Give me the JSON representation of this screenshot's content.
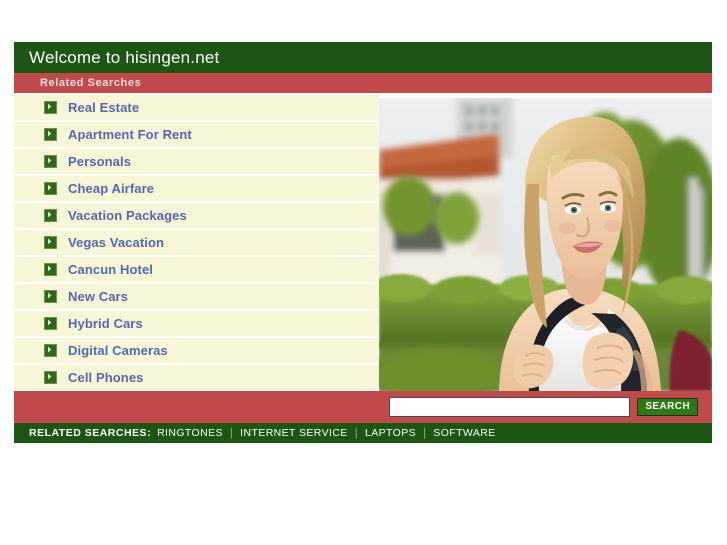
{
  "header": {
    "title": "Welcome to hisingen.net",
    "sub_title": "Related Searches",
    "title_bar_color": "#1b5713",
    "sub_bar_color": "#c24a4a"
  },
  "related_searches": {
    "items": [
      {
        "label": "Real Estate",
        "icon": "arrow-right-icon"
      },
      {
        "label": "Apartment For Rent",
        "icon": "arrow-right-icon"
      },
      {
        "label": "Personals",
        "icon": "arrow-right-icon"
      },
      {
        "label": "Cheap Airfare",
        "icon": "arrow-right-icon"
      },
      {
        "label": "Vacation Packages",
        "icon": "arrow-right-icon"
      },
      {
        "label": "Vegas Vacation",
        "icon": "arrow-right-icon"
      },
      {
        "label": "Cancun Hotel",
        "icon": "arrow-right-icon"
      },
      {
        "label": "New Cars",
        "icon": "arrow-right-icon"
      },
      {
        "label": "Hybrid Cars",
        "icon": "arrow-right-icon"
      },
      {
        "label": "Digital Cameras",
        "icon": "arrow-right-icon"
      },
      {
        "label": "Cell Phones",
        "icon": "arrow-right-icon"
      }
    ],
    "link_color": "#5566b5",
    "row_color": "#f7f7d8"
  },
  "photo": {
    "alt": "Smiling blonde young woman wearing a white top and a black backpack, standing outdoors in front of a tiled-roof building with green hedges and trees",
    "sky_color": "#e9ecec",
    "roof_color": "#c86a42",
    "hedge_color": "#6f9130",
    "hair_color": "#d9b778",
    "skin_color": "#f0cdab",
    "shirt_color": "#fdfdfd",
    "strap_color": "#1c2026"
  },
  "search": {
    "value": "",
    "placeholder": "",
    "button_label": "SEARCH",
    "button_color": "#2d7a14",
    "bar_color": "#c24a4a"
  },
  "footer": {
    "title": "RELATED SEARCHES:",
    "separator": "|",
    "links": [
      "RINGTONES",
      "INTERNET SERVICE",
      "LAPTOPS",
      "SOFTWARE"
    ],
    "bar_color": "#1b5713"
  }
}
